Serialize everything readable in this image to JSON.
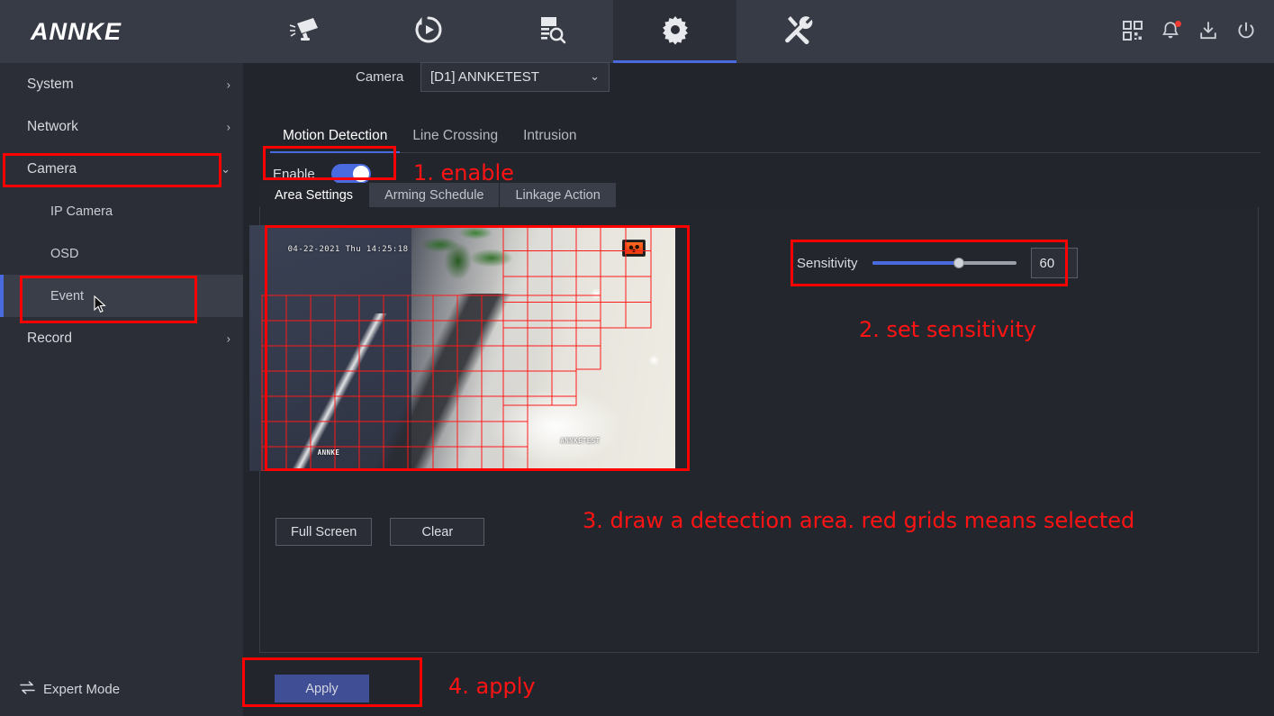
{
  "app": {
    "brand": "ANNKE",
    "nav": [
      {
        "name": "live-view",
        "icon": "camera-icon",
        "active": false
      },
      {
        "name": "playback",
        "icon": "playback-icon",
        "active": false
      },
      {
        "name": "log-search",
        "icon": "log-search-icon",
        "active": false
      },
      {
        "name": "configuration",
        "icon": "gear-icon",
        "active": true
      },
      {
        "name": "maintenance",
        "icon": "tools-icon",
        "active": false
      }
    ],
    "right_icons": [
      {
        "name": "qr-code-icon",
        "badge": false
      },
      {
        "name": "notification-bell-icon",
        "badge": true
      },
      {
        "name": "download-icon",
        "badge": false
      },
      {
        "name": "power-icon",
        "badge": false
      }
    ]
  },
  "sidebar": {
    "items": [
      {
        "label": "System",
        "level": 0,
        "chevron": "›",
        "selected": false,
        "boxed": false
      },
      {
        "label": "Network",
        "level": 0,
        "chevron": "›",
        "selected": false,
        "boxed": false
      },
      {
        "label": "Camera",
        "level": 0,
        "chevron": "⌄",
        "selected": false,
        "boxed": true
      },
      {
        "label": "IP Camera",
        "level": 1,
        "chevron": "",
        "selected": false,
        "boxed": false
      },
      {
        "label": "OSD",
        "level": 1,
        "chevron": "",
        "selected": false,
        "boxed": false
      },
      {
        "label": "Event",
        "level": 1,
        "chevron": "",
        "selected": true,
        "boxed": true
      },
      {
        "label": "Record",
        "level": 0,
        "chevron": "›",
        "selected": false,
        "boxed": false
      }
    ],
    "expert_mode": "Expert Mode"
  },
  "main": {
    "camera_label": "Camera",
    "camera_value": "[D1] ANNKETEST",
    "camera_chevron": "⌄",
    "tabs": [
      {
        "label": "Motion Detection",
        "active": true
      },
      {
        "label": "Line Crossing",
        "active": false
      },
      {
        "label": "Intrusion",
        "active": false
      }
    ],
    "enable_label": "Enable",
    "enable_state": "on",
    "subtabs": [
      {
        "label": "Area Settings",
        "active": true
      },
      {
        "label": "Arming Schedule",
        "active": false
      },
      {
        "label": "Linkage Action",
        "active": false
      }
    ],
    "video": {
      "osd_timestamp": "04-22-2021 Thu 14:25:18",
      "watermark_left": "ANNKE",
      "watermark_right": "ANNKETEST"
    },
    "sensitivity_label": "Sensitivity",
    "sensitivity_value": "60",
    "sensitivity_percent": 60,
    "buttons": {
      "full_screen": "Full Screen",
      "clear": "Clear",
      "apply": "Apply"
    }
  },
  "annotations": [
    {
      "text": "1. enable"
    },
    {
      "text": "2. set sensitivity"
    },
    {
      "text": "3. draw a detection area. red grids means selected"
    },
    {
      "text": "4. apply"
    }
  ],
  "colors": {
    "accent": "#4a6be0",
    "annotation": "#ff1313",
    "topbar": "#373b45",
    "sidebar": "#2b2e36",
    "background": "#23252d",
    "apply_button": "#3f4e95"
  }
}
